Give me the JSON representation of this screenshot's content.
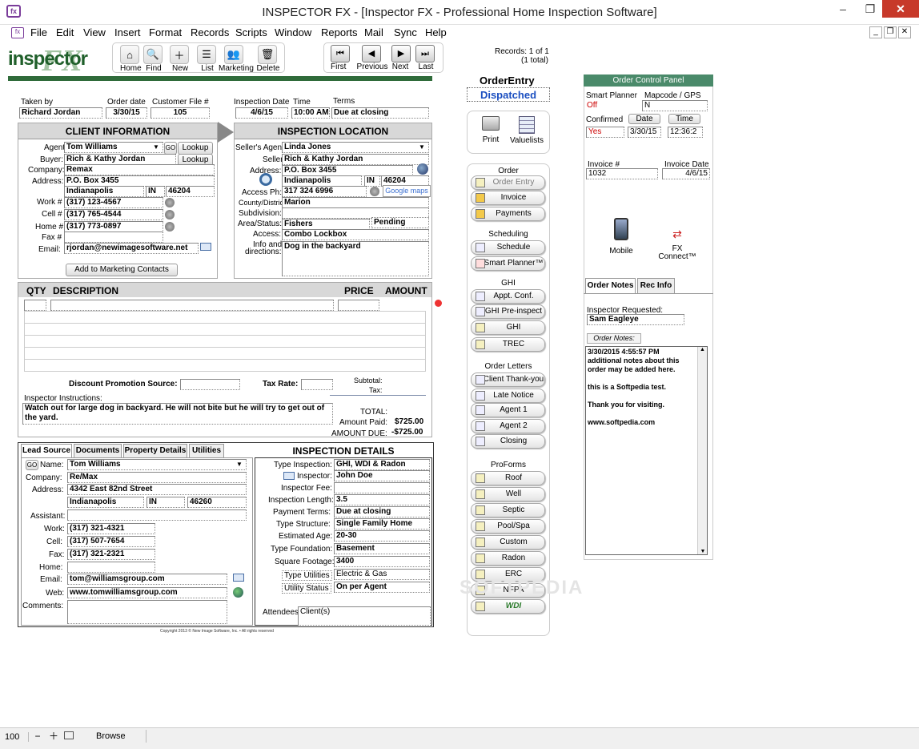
{
  "window": {
    "title": "INSPECTOR FX - [Inspector FX - Professional Home Inspection Software]",
    "minimize": "–",
    "restore": "❐",
    "close": "✕",
    "doc_min": "_",
    "doc_restore": "❐",
    "doc_close": "✕"
  },
  "menu": [
    "File",
    "Edit",
    "View",
    "Insert",
    "Format",
    "Records",
    "Scripts",
    "Window",
    "Reports",
    "Mail",
    "Sync",
    "Help"
  ],
  "logo": "inspector FX",
  "toolbar": {
    "home": "Home",
    "find": "Find",
    "new": "New",
    "list": "List",
    "marketing": "Marketing",
    "delete": "Delete",
    "first": "First",
    "previous": "Previous",
    "next": "Next",
    "last": "Last"
  },
  "records": {
    "line1": "Records: 1 of 1",
    "line2": "(1 total)"
  },
  "order": {
    "taken_by_label": "Taken by",
    "taken_by": "Richard Jordan",
    "order_date_label": "Order date",
    "order_date": "3/30/15",
    "customer_file_label": "Customer File #",
    "customer_file": "105",
    "insp_date_label": "Inspection Date",
    "insp_date": "4/6/15",
    "time_label": "Time",
    "time": "10:00 AM",
    "terms_label": "Terms",
    "terms": "Due at closing"
  },
  "client": {
    "header": "CLIENT INFORMATION",
    "agent_label": "Agent",
    "agent": "Tom Williams",
    "go": "GO",
    "lookup": "Lookup",
    "buyer_label": "Buyer:",
    "buyer": "Rich & Kathy Jordan",
    "company_label": "Company:",
    "company": "Remax",
    "address_label": "Address:",
    "address": "P.O. Box 3455",
    "city": "Indianapolis",
    "state": "IN",
    "zip": "46204",
    "work_label": "Work #",
    "work": "(317) 123-4567",
    "cell_label": "Cell #",
    "cell": "(317) 765-4544",
    "home_label": "Home #",
    "home": "(317) 773-0897",
    "fax_label": "Fax #",
    "fax": "",
    "email_label": "Email:",
    "email": "rjordan@newimagesoftware.net",
    "add_marketing": "Add to Marketing Contacts"
  },
  "location": {
    "header": "INSPECTION LOCATION",
    "seller_agent_label": "Seller's Agent",
    "seller_agent": "Linda Jones",
    "seller_label": "Seller",
    "seller": "Rich & Kathy Jordan",
    "address_label": "Address:",
    "address": "P.O. Box 3455",
    "city": "Indianapolis",
    "state": "IN",
    "zip": "46204",
    "access_ph_label": "Access Ph:",
    "access_ph": "317 324 6996",
    "google": "Google maps",
    "county_label": "County/District:",
    "county": "Marion",
    "subdivision_label": "Subdivision:",
    "subdivision": "",
    "area_label": "Area/Status:",
    "area": "Fishers",
    "status": "Pending",
    "access_label": "Access:",
    "access": "Combo Lockbox",
    "info_label1": "Info and",
    "info_label2": "directions:",
    "info": "Dog in the backyard"
  },
  "items": {
    "qty": "QTY",
    "desc": "DESCRIPTION",
    "price": "PRICE",
    "amount": "AMOUNT",
    "discount_label": "Discount Promotion Source:",
    "tax_rate_label": "Tax Rate:",
    "subtotal_label": "Subtotal:",
    "tax_label": "Tax:",
    "instructions_label": "Inspector Instructions:",
    "instructions": "Watch out for large dog in backyard. He will not bite but he will try to get out of the yard.",
    "total_label": "TOTAL:",
    "paid_label": "Amount Paid:",
    "paid": "$725.00",
    "due_label": "AMOUNT DUE:",
    "due": "-$725.00"
  },
  "tabs": [
    "Lead Source",
    "Documents",
    "Property Details",
    "Utilities"
  ],
  "lead": {
    "go": "GO",
    "name_label": "Name:",
    "name": "Tom Williams",
    "company_label": "Company:",
    "company": "Re/Max",
    "address_label": "Address:",
    "address": "4342 East 82nd Street",
    "city": "Indianapolis",
    "state": "IN",
    "zip": "46260",
    "assistant_label": "Assistant:",
    "work_label": "Work:",
    "work": "(317) 321-4321",
    "cell_label": "Cell:",
    "cell": "(317) 507-7654",
    "fax_label": "Fax:",
    "fax": "(317) 321-2321",
    "home_label": "Home:",
    "email_label": "Email:",
    "email": "tom@williamsgroup.com",
    "web_label": "Web:",
    "web": "www.tomwilliamsgroup.com",
    "comments_label": "Comments:"
  },
  "details": {
    "header": "INSPECTION DETAILS",
    "type_label": "Type Inspection:",
    "type": "GHI, WDI & Radon",
    "inspector_label": "Inspector:",
    "inspector": "John Doe",
    "fee_label": "Inspector Fee:",
    "length_label": "Inspection Length:",
    "length": "3.5",
    "terms_label": "Payment Terms:",
    "terms": "Due at closing",
    "structure_label": "Type Structure:",
    "structure": "Single Family Home",
    "age_label": "Estimated Age:",
    "age": "20-30",
    "foundation_label": "Type Foundation:",
    "foundation": "Basement",
    "sqft_label": "Square Footage:",
    "sqft": "3400",
    "utilities_label": "Type Utilities",
    "utilities": "Electric & Gas",
    "utility_status_label": "Utility Status",
    "utility_status": "On per Agent",
    "attendees_label": "Attendees",
    "attendees": "Client(s)"
  },
  "copyright": "Copyright 2013 © New Image Software, Inc. • All rights reserved",
  "mid": {
    "order_entry": "OrderEntry",
    "dispatched": "Dispatched",
    "print": "Print",
    "valuelists": "Valuelists",
    "order_group": "Order",
    "order_buttons": [
      "Order Entry",
      "Invoice",
      "Payments"
    ],
    "sched_group": "Scheduling",
    "sched_buttons": [
      "Schedule",
      "Smart Planner™"
    ],
    "ghi_group": "GHI",
    "ghi_buttons": [
      "Appt. Conf.",
      "GHI Pre-inspect",
      "GHI",
      "TREC"
    ],
    "letters_group": "Order Letters",
    "letters_buttons": [
      "Client Thank-you",
      "Late Notice",
      "Agent 1",
      "Agent 2",
      "Closing"
    ],
    "proforms_group": "ProForms",
    "proforms_buttons": [
      "Roof",
      "Well",
      "Septic",
      "Pool/Spa",
      "Custom",
      "Radon",
      "ERC",
      "NFPA",
      "WDI"
    ]
  },
  "panel": {
    "header": "Order Control Panel",
    "smart_planner_label": "Smart Planner",
    "smart_planner": "Off",
    "mapcode_label": "Mapcode / GPS",
    "mapcode": "N",
    "confirmed_label": "Confirmed",
    "date_btn": "Date",
    "time_btn": "Time",
    "confirmed": "Yes",
    "confirmed_date": "3/30/15",
    "confirmed_time": "12:36:2",
    "invoice_label": "Invoice #",
    "invoice": "1032",
    "invoice_date_label": "Invoice Date",
    "invoice_date": "4/6/15",
    "mobile": "Mobile",
    "fx_connect1": "FX",
    "fx_connect2": "Connect™",
    "tab_notes": "Order Notes",
    "tab_rec": "Rec Info",
    "inspector_req_label": "Inspector Requested:",
    "inspector_req": "Sam Eagleye",
    "order_notes_btn": "Order Notes:",
    "notes_lines": [
      "3/30/2015 4:55:57 PM",
      "additional notes about this",
      "order may be added here.",
      "",
      "this is a Softpedia test.",
      "",
      "Thank you for visiting.",
      "",
      "www.softpedia.com"
    ]
  },
  "status": {
    "zoom": "100",
    "mode": "Browse"
  },
  "watermark": "SOFTPEDIA"
}
